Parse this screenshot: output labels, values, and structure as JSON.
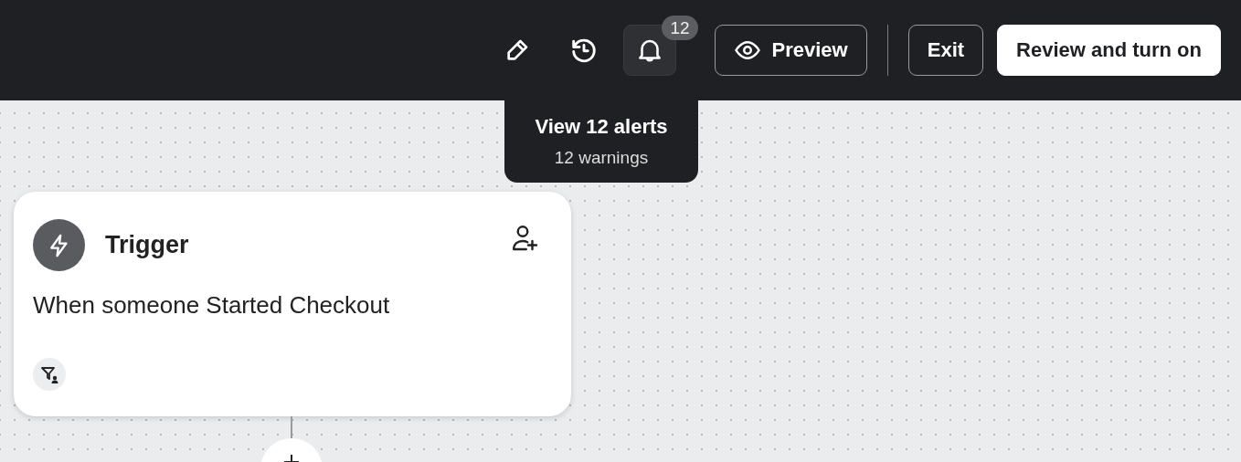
{
  "toolbar": {
    "alerts_badge": "12",
    "buttons": [
      {
        "label": "Preview",
        "kind": "outline"
      },
      {
        "label": "Exit",
        "kind": "outline"
      },
      {
        "label": "Review and turn on",
        "kind": "primary"
      }
    ]
  },
  "tooltip": {
    "title": "View 12 alerts",
    "subtitle": "12 warnings"
  },
  "trigger_card": {
    "title": "Trigger",
    "description": "When someone Started Checkout"
  }
}
